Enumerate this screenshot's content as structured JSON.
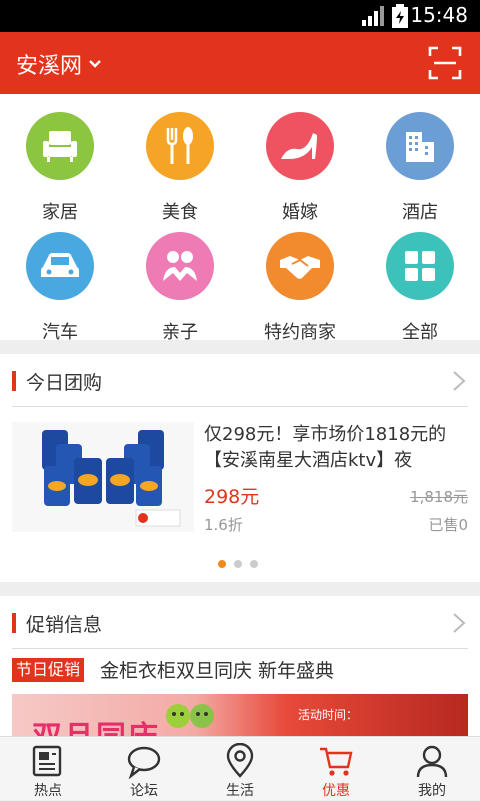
{
  "status": {
    "time": "15:48"
  },
  "header": {
    "city": "安溪网"
  },
  "categories": [
    {
      "label": "家居",
      "color": "#8cc53f"
    },
    {
      "label": "美食",
      "color": "#f6a425"
    },
    {
      "label": "婚嫁",
      "color": "#ef5361"
    },
    {
      "label": "酒店",
      "color": "#6c9ed6"
    },
    {
      "label": "汽车",
      "color": "#4aa8e0"
    },
    {
      "label": "亲子",
      "color": "#ee7bb4"
    },
    {
      "label": "特约商家",
      "color": "#f28a2e"
    },
    {
      "label": "全部",
      "color": "#3cc2bb"
    }
  ],
  "group_buy": {
    "title": "今日团购",
    "deal_title": "仅298元！享市场价1818元的【安溪南星大酒店ktv】夜",
    "price": "298元",
    "original_price": "1,818元",
    "discount": "1.6折",
    "sold": "已售0",
    "page": 1,
    "pages": 3
  },
  "promo": {
    "title": "促销信息",
    "tag": "节日促销",
    "headline": "金柜衣柜双旦同庆 新年盛典",
    "banner_text": "双旦同庆",
    "banner_info": "活动时间："
  },
  "tabs": [
    {
      "label": "热点",
      "icon": "news-icon"
    },
    {
      "label": "论坛",
      "icon": "chat-bubble-icon"
    },
    {
      "label": "生活",
      "icon": "location-pin-icon"
    },
    {
      "label": "优惠",
      "icon": "cart-icon"
    },
    {
      "label": "我的",
      "icon": "user-icon"
    }
  ],
  "active_tab": "优惠"
}
